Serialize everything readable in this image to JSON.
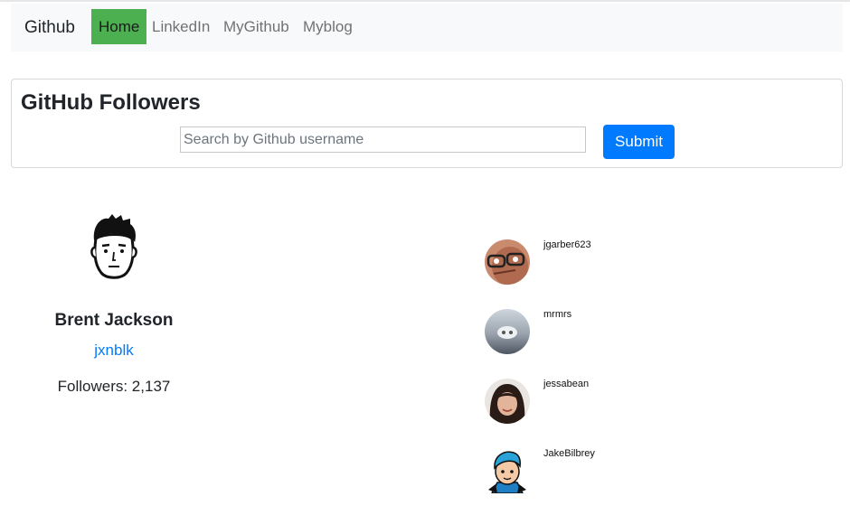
{
  "navbar": {
    "brand": "Github",
    "items": [
      {
        "label": "Home",
        "active": true
      },
      {
        "label": "LinkedIn",
        "active": false
      },
      {
        "label": "MyGithub",
        "active": false
      },
      {
        "label": "Myblog",
        "active": false
      }
    ],
    "active_color": "#4caf50"
  },
  "search": {
    "title": "GitHub Followers",
    "placeholder": "Search by Github username",
    "value": "",
    "submit_label": "Submit",
    "button_color": "#007bff"
  },
  "profile": {
    "avatar_icon": "cartoon-face-avatar",
    "name": "Brent Jackson",
    "login": "jxnblk",
    "followers": "Followers: 2,137"
  },
  "followers": [
    {
      "username": "jgarber623",
      "avatar_icon": "photo-avatar-glasses"
    },
    {
      "username": "mrmrs",
      "avatar_icon": "photo-avatar-cloud"
    },
    {
      "username": "jessabean",
      "avatar_icon": "photo-avatar-woman"
    },
    {
      "username": "JakeBilbrey",
      "avatar_icon": "cartoon-avatar-blue-hair"
    }
  ]
}
